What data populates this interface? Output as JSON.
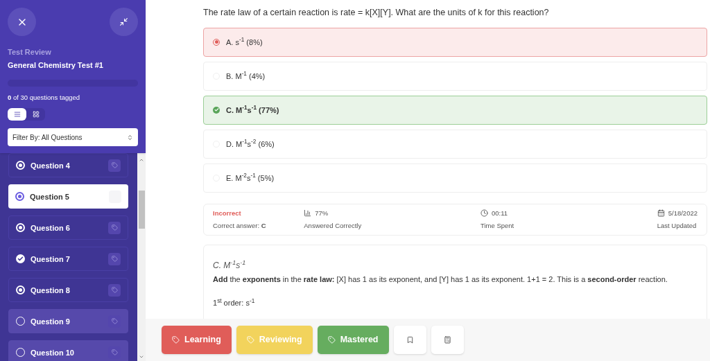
{
  "sidebar": {
    "label": "Test Review",
    "title": "General Chemistry Test #1",
    "progress": {
      "level": 0
    },
    "tagged_count": "0",
    "tagged_text": "of 30 questions tagged",
    "view_toggle": [
      {
        "kind": "list",
        "selected": true
      },
      {
        "kind": "grid",
        "selected": false
      }
    ],
    "filter": {
      "value": "Filter By: All Questions"
    },
    "questions": [
      {
        "label": "Question 4",
        "kind": "answered",
        "selected": false
      },
      {
        "label": "Question 5",
        "kind": "answered",
        "selected": true
      },
      {
        "label": "Question 6",
        "kind": "answered",
        "selected": false
      },
      {
        "label": "Question 7",
        "kind": "correct",
        "selected": false
      },
      {
        "label": "Question 8",
        "kind": "answered",
        "selected": false
      },
      {
        "label": "Question 9",
        "kind": "unanswered",
        "selected": false
      },
      {
        "label": "Question 10",
        "kind": "unanswered",
        "selected": false
      }
    ]
  },
  "question": {
    "text": "The rate law of a certain reaction is rate = k[X][Y]. What are the units of k for this reaction?",
    "options": [
      {
        "text": "A. s$^{-1}$ (8%)",
        "selected": true,
        "correct": false
      },
      {
        "text": "B. M$^{-1}$ (4%)",
        "selected": false,
        "correct": false
      },
      {
        "text": "C. M$^{-1}$s$^{-1}$ (77%)",
        "selected": false,
        "correct": true
      },
      {
        "text": "D. M$^{-1}$s$^{-2}$ (6%)",
        "selected": false,
        "correct": false
      },
      {
        "text": "E. M$^{-2}$s$^{-1}$ (5%)",
        "selected": false,
        "correct": false
      }
    ]
  },
  "stats": {
    "result": "Incorrect",
    "correct_answer": "Correct answer: **C**",
    "items": [
      {
        "kind": "percent",
        "value": "77%",
        "label": "Answered Correctly"
      },
      {
        "kind": "time",
        "value": "00:11",
        "label": "Time Spent"
      },
      {
        "kind": "date",
        "value": "5/18/2022",
        "label": "Last Updated"
      }
    ]
  },
  "explanation": {
    "answer": "C. M$^{-1}$s$^{-1}$",
    "text": "**Add** the **exponents** in the **rate law:** [X] has 1 as its exponent, and [Y] has 1 as its exponent. 1+1 = 2. This is a **second-order** reaction.",
    "lines": [
      "1$^{st}$ order: s$^{-1}$"
    ]
  },
  "footer": {
    "tags": [
      {
        "label": "Learning",
        "color": "#e05d59"
      },
      {
        "label": "Reviewing",
        "color": "#f2d35c"
      },
      {
        "label": "Mastered",
        "color": "#66ad5f"
      }
    ],
    "icon_buttons": [
      {
        "kind": "bookmark"
      },
      {
        "kind": "calculator"
      }
    ]
  }
}
